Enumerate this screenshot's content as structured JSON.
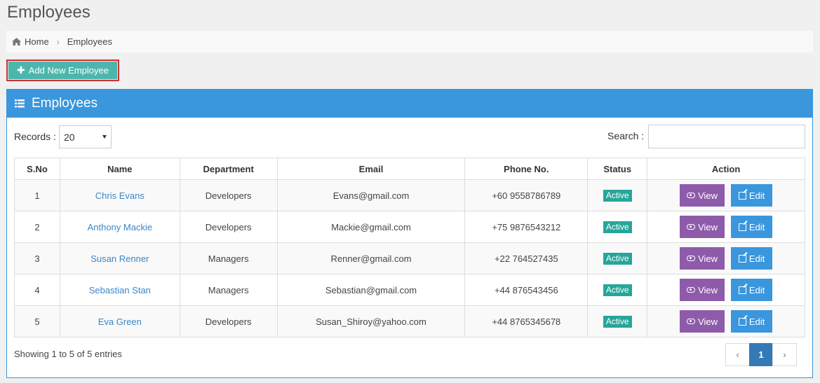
{
  "page": {
    "title": "Employees"
  },
  "breadcrumb": {
    "home_label": "Home",
    "separator": "›",
    "current": "Employees"
  },
  "add_button": {
    "label": "Add New Employee",
    "icon": "plus-icon"
  },
  "panel": {
    "title": "Employees",
    "icon": "list-icon",
    "color": "#3a96dd"
  },
  "controls": {
    "records_label": "Records :",
    "records_value": "20",
    "search_label": "Search :",
    "search_value": ""
  },
  "table": {
    "columns": [
      "S.No",
      "Name",
      "Department",
      "Email",
      "Phone No.",
      "Status",
      "Action"
    ],
    "rows": [
      {
        "sno": "1",
        "name": "Chris Evans",
        "department": "Developers",
        "email": "Evans@gmail.com",
        "phone": "+60 9558786789",
        "status": "Active",
        "view": "View",
        "edit": "Edit"
      },
      {
        "sno": "2",
        "name": "Anthony Mackie",
        "department": "Developers",
        "email": "Mackie@gmail.com",
        "phone": "+75 9876543212",
        "status": "Active",
        "view": "View",
        "edit": "Edit"
      },
      {
        "sno": "3",
        "name": "Susan Renner",
        "department": "Managers",
        "email": "Renner@gmail.com",
        "phone": "+22 764527435",
        "status": "Active",
        "view": "View",
        "edit": "Edit"
      },
      {
        "sno": "4",
        "name": "Sebastian Stan",
        "department": "Managers",
        "email": "Sebastian@gmail.com",
        "phone": "+44 876543456",
        "status": "Active",
        "view": "View",
        "edit": "Edit"
      },
      {
        "sno": "5",
        "name": "Eva Green",
        "department": "Developers",
        "email": "Susan_Shiroy@yahoo.com",
        "phone": "+44 8765345678",
        "status": "Active",
        "view": "View",
        "edit": "Edit"
      }
    ]
  },
  "footer": {
    "info": "Showing 1 to 5 of 5 entries",
    "pager_prev": "‹",
    "pager_page": "1",
    "pager_next": "›"
  },
  "colors": {
    "status_badge": "#26a69a",
    "view_button": "#8e5bab",
    "edit_button": "#3a96dd",
    "add_button": "#4db6ac",
    "link": "#3a87c8"
  }
}
